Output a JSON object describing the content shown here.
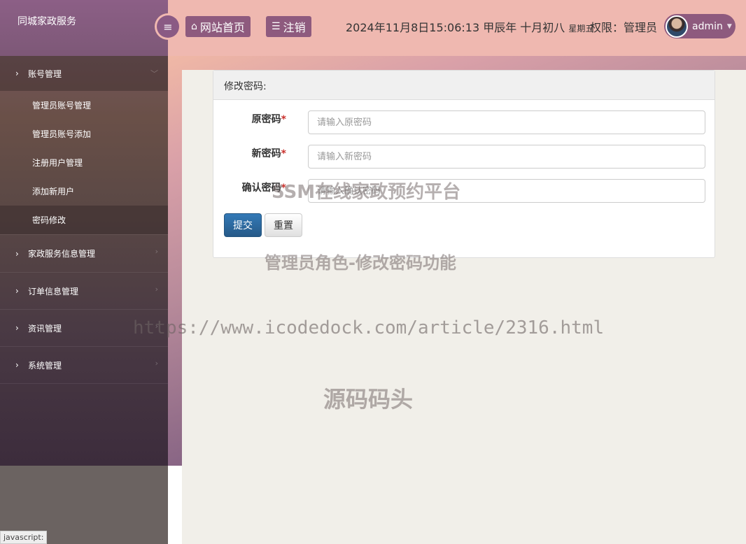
{
  "brand": "同城家政服务",
  "topbar": {
    "home_label": "网站首页",
    "logout_label": "注销",
    "date": "2024年11月8日15:06:13 甲辰年 十月初八",
    "weekday": "星期五",
    "role_text": "权限：管理员",
    "username": "admin"
  },
  "sidebar": {
    "groups": [
      {
        "label": "账号管理",
        "items": [
          "管理员账号管理",
          "管理员账号添加",
          "注册用户管理",
          "添加新用户",
          "密码修改"
        ]
      },
      {
        "label": "家政服务信息管理"
      },
      {
        "label": "订单信息管理"
      },
      {
        "label": "资讯管理"
      },
      {
        "label": "系统管理"
      }
    ]
  },
  "panel": {
    "title": "修改密码:",
    "fields": [
      {
        "label": "原密码",
        "placeholder": "请输入原密码"
      },
      {
        "label": "新密码",
        "placeholder": "请输入新密码"
      },
      {
        "label": "确认密码",
        "placeholder": "请输入确认密码"
      }
    ],
    "required_mark": "*",
    "submit_label": "提交",
    "reset_label": "重置"
  },
  "watermarks": {
    "line1": "SSM在线家政预约平台",
    "line2": "管理员角色-修改密码功能",
    "line3": "https://www.icodedock.com/article/2316.html",
    "line4": "源码码头"
  },
  "statusbar": "javascript:",
  "colors": {
    "accent": "#8e5a7e",
    "topbar": "#efb8b0",
    "primary_button": "#337ab7"
  }
}
